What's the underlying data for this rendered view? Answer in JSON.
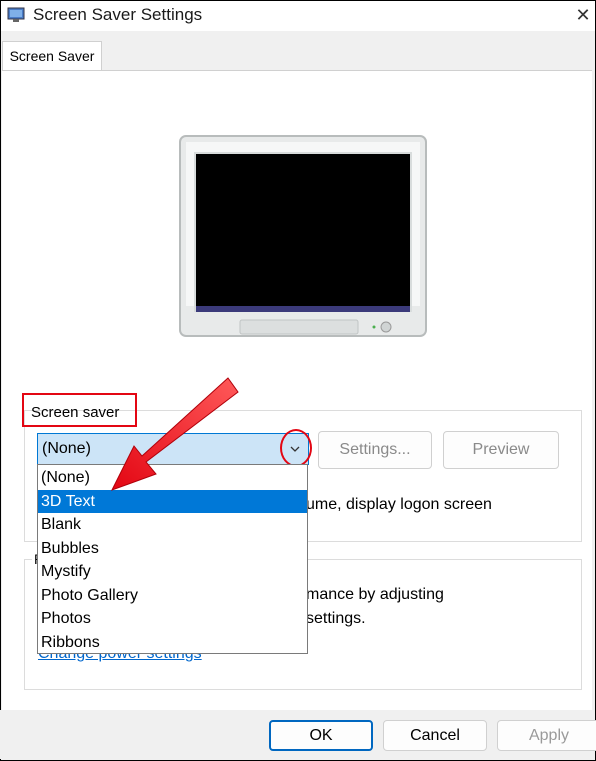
{
  "window": {
    "title": "Screen Saver Settings",
    "close_glyph": "✕"
  },
  "tabs": [
    {
      "label": "Screen Saver"
    }
  ],
  "screen_saver": {
    "group_label": "Screen saver",
    "selected_value": "(None)",
    "settings_button": "Settings...",
    "preview_button": "Preview",
    "resume_text_fragment": "ume, display logon screen",
    "options": [
      {
        "label": "(None)",
        "selected": false
      },
      {
        "label": "3D Text",
        "selected": true
      },
      {
        "label": "Blank",
        "selected": false
      },
      {
        "label": "Bubbles",
        "selected": false
      },
      {
        "label": "Mystify",
        "selected": false
      },
      {
        "label": "Photo Gallery",
        "selected": false
      },
      {
        "label": "Photos",
        "selected": false
      },
      {
        "label": "Ribbons",
        "selected": false
      }
    ]
  },
  "power": {
    "group_label_fragment": "P",
    "text_line1_fragment": "mance by adjusting",
    "text_line2_fragment": "settings.",
    "link": "Change power settings"
  },
  "footer": {
    "ok": "OK",
    "cancel": "Cancel",
    "apply": "Apply"
  },
  "colors": {
    "highlight": "#0078d7",
    "annotation_red": "#e30613",
    "link": "#0066cc"
  }
}
